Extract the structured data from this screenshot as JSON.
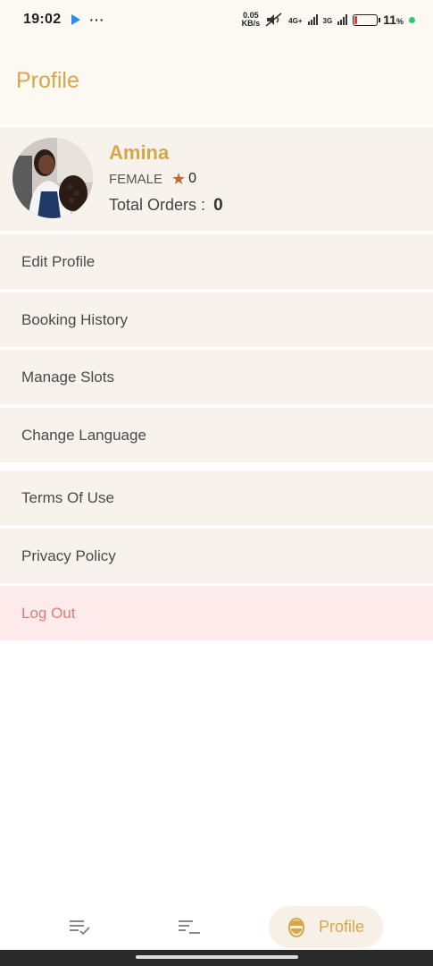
{
  "status_bar": {
    "time": "19:02",
    "speed_value": "0.05",
    "speed_unit": "KB/s",
    "net1": "4G+",
    "net2": "3G",
    "battery": "11",
    "battery_unit": "%"
  },
  "header": {
    "title": "Profile"
  },
  "profile": {
    "name": "Amina",
    "gender": "FEMALE",
    "rating": "0",
    "orders_label": "Total Orders :",
    "orders_value": "0"
  },
  "menu": [
    {
      "label": "Edit Profile"
    },
    {
      "label": "Booking History"
    },
    {
      "label": "Manage Slots"
    },
    {
      "label": "Change Language"
    },
    {
      "label": "Terms Of Use"
    },
    {
      "label": "Privacy Policy"
    },
    {
      "label": "Log Out"
    }
  ],
  "bottom_nav": {
    "items": [
      {
        "icon": "task-list-icon"
      },
      {
        "icon": "list-icon"
      },
      {
        "icon": "barber-face-icon",
        "label": "Profile",
        "active": true
      }
    ]
  },
  "colors": {
    "accent": "#d7a64a",
    "card_bg": "#f7f3ec",
    "logout_bg": "#fcebea",
    "logout_text": "#e07a7a",
    "star": "#c26a2a"
  }
}
